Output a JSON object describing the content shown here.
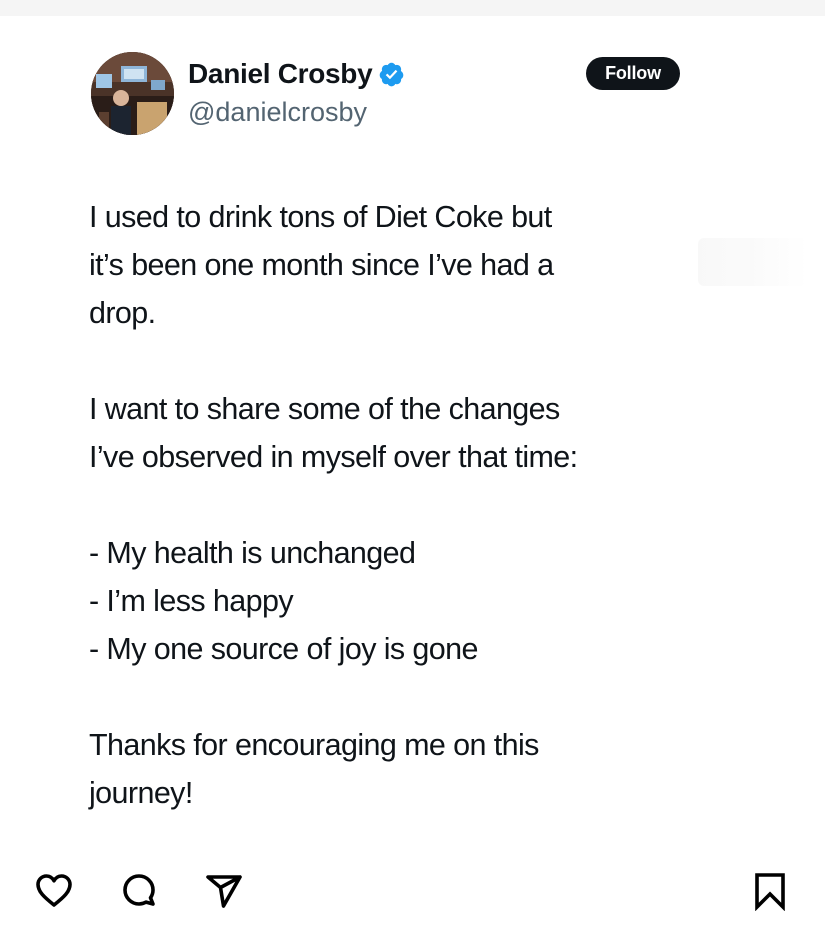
{
  "tweet": {
    "display_name": "Daniel Crosby",
    "handle": "@danielcrosby",
    "follow_label": "Follow",
    "verified": true,
    "paragraphs": [
      [
        "I used to drink tons of Diet Coke but",
        "it’s been one month since I’ve had a",
        "drop."
      ],
      [
        "I want to share some of the changes",
        "I’ve observed in myself over that time:"
      ],
      [
        "- My health is unchanged",
        "- I’m less happy",
        "- My one source of joy is gone"
      ],
      [
        "Thanks for encouraging me on this",
        "journey!"
      ]
    ]
  },
  "actions": {
    "icons": [
      "heart-icon",
      "comment-icon",
      "share-icon",
      "bookmark-icon"
    ]
  },
  "colors": {
    "text": "#0f1419",
    "handle": "#536471",
    "verified": "#1d9bf0",
    "follow_bg": "#0f1419",
    "follow_text": "#ffffff"
  }
}
